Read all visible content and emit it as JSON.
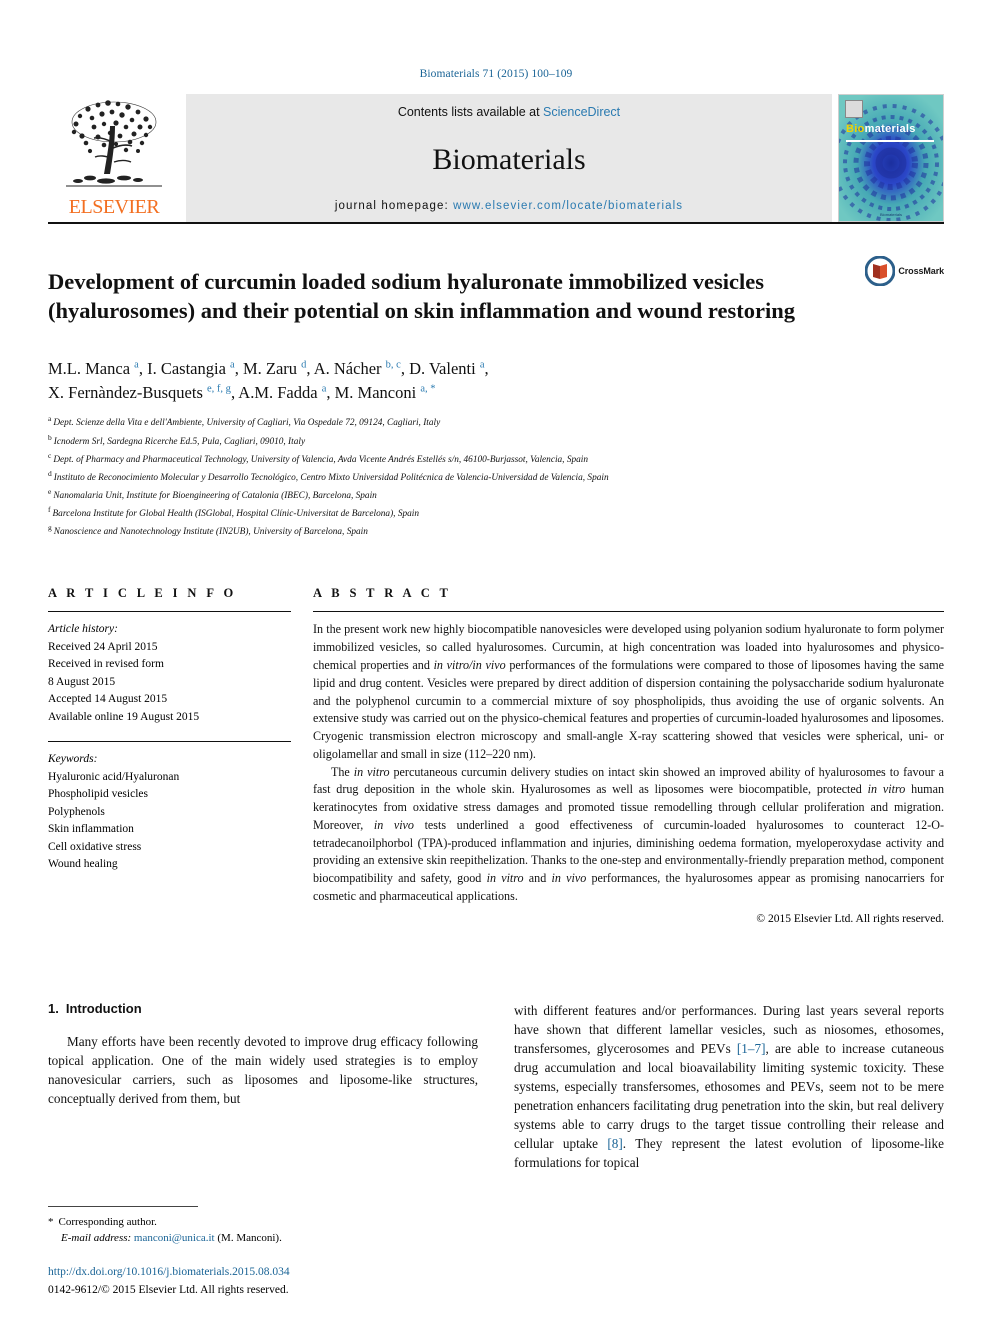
{
  "running_head": "Biomaterials 71 (2015) 100–109",
  "masthead": {
    "publisher": "ELSEVIER",
    "contents_prefix": "Contents lists available at ",
    "contents_link": "ScienceDirect",
    "journal": "Biomaterials",
    "homepage_prefix": "journal homepage: ",
    "homepage_url": "www.elsevier.com/locate/biomaterials",
    "cover_title_1": "Bio",
    "cover_title_2": "materials",
    "cover_footer": "Biomaterials"
  },
  "crossmark": {
    "label": "CrossMark"
  },
  "article": {
    "title": "Development of curcumin loaded sodium hyaluronate immobilized vesicles (hyalurosomes) and their potential on skin inflammation and wound restoring",
    "authors_line_1": "M.L. Manca <sup>a</sup>, I. Castangia <sup>a</sup>, M. Zaru <sup>d</sup>, A. Nácher <sup>b, c</sup>, D. Valenti <sup>a</sup>,",
    "authors_line_2": "X. Fernàndez-Busquets <sup>e, f, g</sup>, A.M. Fadda <sup>a</sup>, M. Manconi <sup>a, *</sup>",
    "affiliations": [
      {
        "mark": "a",
        "text": "Dept. Scienze della Vita e dell'Ambiente, University of Cagliari, Via Ospedale 72, 09124, Cagliari, Italy"
      },
      {
        "mark": "b",
        "text": "Icnoderm Srl, Sardegna Ricerche Ed.5, Pula, Cagliari, 09010, Italy"
      },
      {
        "mark": "c",
        "text": "Dept. of Pharmacy and Pharmaceutical Technology, University of Valencia, Avda Vicente Andrés Estellés s/n, 46100-Burjassot, Valencia, Spain"
      },
      {
        "mark": "d",
        "text": "Instituto de Reconocimiento Molecular y Desarrollo Tecnológico, Centro Mixto Universidad Politécnica de Valencia-Universidad de Valencia, Spain"
      },
      {
        "mark": "e",
        "text": "Nanomalaria Unit, Institute for Bioengineering of Catalonia (IBEC), Barcelona, Spain"
      },
      {
        "mark": "f",
        "text": "Barcelona Institute for Global Health (ISGlobal, Hospital Clínic-Universitat de Barcelona), Spain"
      },
      {
        "mark": "g",
        "text": "Nanoscience and Nanotechnology Institute (IN2UB), University of Barcelona, Spain"
      }
    ]
  },
  "article_info": {
    "heading": "A R T I C L E   I N F O",
    "history_label": "Article history:",
    "history": [
      "Received 24 April 2015",
      "Received in revised form",
      "8 August 2015",
      "Accepted 14 August 2015",
      "Available online 19 August 2015"
    ],
    "keywords_label": "Keywords:",
    "keywords": [
      "Hyaluronic acid/Hyaluronan",
      "Phospholipid vesicles",
      "Polyphenols",
      "Skin inflammation",
      "Cell oxidative stress",
      "Wound healing"
    ]
  },
  "abstract": {
    "heading": "A B S T R A C T",
    "paragraph_1": "In the present work new highly biocompatible nanovesicles were developed using polyanion sodium hyaluronate to form polymer immobilized vesicles, so called hyalurosomes. Curcumin, at high concentration was loaded into hyalurosomes and physico-chemical properties and <i>in vitro/in vivo</i> performances of the formulations were compared to those of liposomes having the same lipid and drug content. Vesicles were prepared by direct addition of dispersion containing the polysaccharide sodium hyaluronate and the polyphenol curcumin to a commercial mixture of soy phospholipids, thus avoiding the use of organic solvents. An extensive study was carried out on the physico-chemical features and properties of curcumin-loaded hyalurosomes and liposomes. Cryogenic transmission electron microscopy and small-angle X-ray scattering showed that vesicles were spherical, uni- or oligolamellar and small in size (112–220 nm).",
    "paragraph_2": "The <i>in vitro</i> percutaneous curcumin delivery studies on intact skin showed an improved ability of hyalurosomes to favour a fast drug deposition in the whole skin. Hyalurosomes as well as liposomes were biocompatible, protected <i>in vitro</i> human keratinocytes from oxidative stress damages and promoted tissue remodelling through cellular proliferation and migration. Moreover, <i>in vivo</i> tests underlined a good effectiveness of curcumin-loaded hyalurosomes to counteract 12-O-tetradecanoilphorbol (TPA)-produced inflammation and injuries, diminishing oedema formation, myeloperoxydase activity and providing an extensive skin reepithelization. Thanks to the one-step and environmentally-friendly preparation method, component biocompatibility and safety, good <i>in vitro</i> and <i>in vivo</i> performances, the hyalurosomes appear as promising nanocarriers for cosmetic and pharmaceutical applications.",
    "copyright": "© 2015 Elsevier Ltd. All rights reserved."
  },
  "introduction": {
    "number": "1.",
    "heading": "Introduction",
    "column_left": "Many efforts have been recently devoted to improve drug efficacy following topical application. One of the main widely used strategies is to employ nanovesicular carriers, such as liposomes and liposome-like structures, conceptually derived from them, but",
    "column_right": "with different features and/or performances. During last years several reports have shown that different lamellar vesicles, such as niosomes, ethosomes, transfersomes, glycerosomes and PEVs <a>[1–7]</a>, are able to increase cutaneous drug accumulation and local bioavailability limiting systemic toxicity. These systems, especially transfersomes, ethosomes and PEVs, seem not to be mere penetration enhancers facilitating drug penetration into the skin, but real delivery systems able to carry drugs to the target tissue controlling their release and cellular uptake <a>[8]</a>. They represent the latest evolution of liposome-like formulations for topical"
  },
  "footnote": {
    "star": "*",
    "corresponding": "Corresponding author.",
    "email_label": "E-mail address:",
    "email": "manconi@unica.it",
    "email_suffix": "(M. Manconi).",
    "doi": "http://dx.doi.org/10.1016/j.biomaterials.2015.08.034",
    "issn": "0142-9612/© 2015 Elsevier Ltd. All rights reserved."
  }
}
